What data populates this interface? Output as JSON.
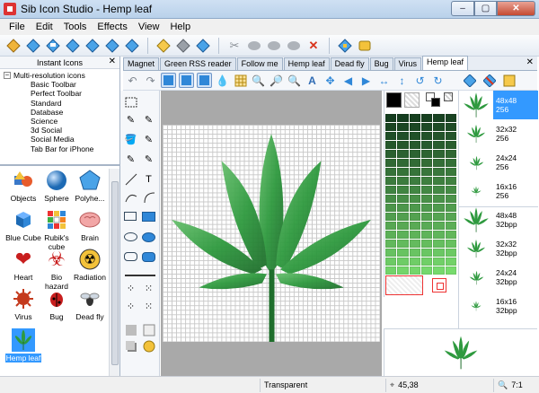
{
  "window": {
    "title": "Sib Icon Studio - Hemp leaf",
    "min": "–",
    "max": "▢",
    "close": "✕"
  },
  "menu": [
    "File",
    "Edit",
    "Tools",
    "Effects",
    "View",
    "Help"
  ],
  "left_panel": {
    "header": "Instant Icons",
    "close": "✕",
    "tree_root": "Multi-resolution icons",
    "tree_items": [
      "Basic Toolbar",
      "Perfect Toolbar",
      "Standard",
      "Database",
      "Science",
      "3d Social",
      "Social Media",
      "Tab Bar for iPhone"
    ],
    "icons": [
      {
        "label": "Objects"
      },
      {
        "label": "Sphere"
      },
      {
        "label": "Polyhe..."
      },
      {
        "label": "Blue Cube"
      },
      {
        "label": "Rubik's cube"
      },
      {
        "label": "Brain"
      },
      {
        "label": "Heart"
      },
      {
        "label": "Bio hazard"
      },
      {
        "label": "Radiation"
      },
      {
        "label": "Virus"
      },
      {
        "label": "Bug"
      },
      {
        "label": "Dead fly"
      },
      {
        "label": "Hemp leaf"
      }
    ]
  },
  "tabs": [
    "Magnet",
    "Green RSS reader",
    "Follow me",
    "Hemp leaf",
    "Dead fly",
    "Bug",
    "Virus",
    "Hemp leaf"
  ],
  "tabs_close": "✕",
  "formats": [
    {
      "size": "48x48",
      "depth": "256"
    },
    {
      "size": "32x32",
      "depth": "256"
    },
    {
      "size": "24x24",
      "depth": "256"
    },
    {
      "size": "16x16",
      "depth": "256"
    },
    {
      "size": "48x48",
      "depth": "32bpp"
    },
    {
      "size": "32x32",
      "depth": "32bpp"
    },
    {
      "size": "24x24",
      "depth": "32bpp"
    },
    {
      "size": "16x16",
      "depth": "32bpp"
    }
  ],
  "status": {
    "transparent": "Transparent",
    "coords": "45,38",
    "zoom": "7:1"
  },
  "colors": {
    "leaf_dark": "#1f6e2c",
    "leaf_mid": "#2f9a3f",
    "leaf_light": "#69c06f",
    "selection": "#3399ff"
  }
}
